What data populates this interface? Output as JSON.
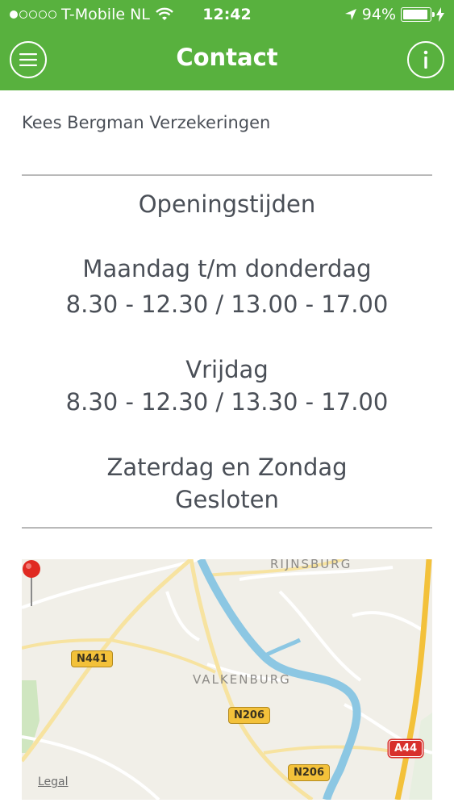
{
  "status_bar": {
    "carrier": "T-Mobile NL",
    "time": "12:42",
    "battery_percent": "94%",
    "battery_level": 0.94,
    "signal_dots_filled": 1,
    "signal_dots_total": 5
  },
  "nav": {
    "title": "Contact",
    "menu_icon": "menu-icon",
    "info_icon": "info-icon"
  },
  "company": {
    "name": "Kees Bergman Verzekeringen"
  },
  "opening_hours": {
    "title": "Openingstijden",
    "blocks": [
      {
        "days": "Maandag t/m donderdag",
        "times": "8.30 - 12.30 / 13.00 - 17.00"
      },
      {
        "days": "Vrijdag",
        "times": "8.30 - 12.30 / 13.30 - 17.00"
      },
      {
        "days": "Zaterdag en Zondag",
        "times": "Gesloten"
      }
    ]
  },
  "map": {
    "places": [
      "RIJNSBURG",
      "VALKENBURG"
    ],
    "roads": [
      "N441",
      "N206",
      "N206",
      "A44"
    ],
    "legal": "Legal"
  },
  "colors": {
    "brand_green": "#58b13e",
    "text_gray": "#4a4f57",
    "divider": "#b9b9b9",
    "water": "#8cc7e3",
    "road": "#f3c13a"
  }
}
